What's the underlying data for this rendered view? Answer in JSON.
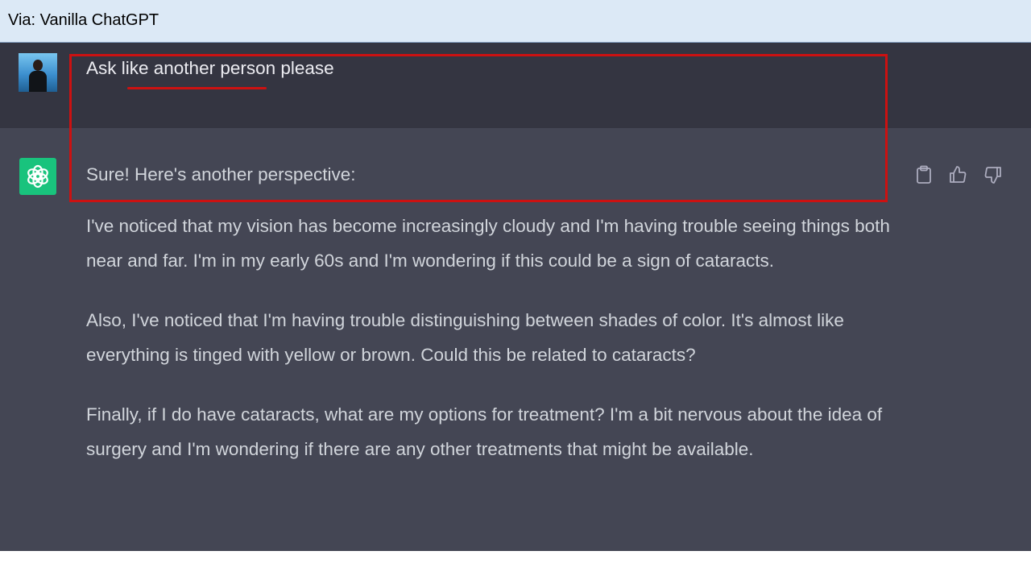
{
  "window": {
    "title": "Via: Vanilla ChatGPT"
  },
  "conversation": {
    "user_message": "Ask like another person please",
    "assistant": {
      "intro": "Sure! Here's another perspective:",
      "paragraphs": [
        "I've noticed that my vision has become increasingly cloudy and I'm having trouble seeing things both near and far. I'm in my early 60s and I'm wondering if this could be a sign of cataracts.",
        "Also, I've noticed that I'm having trouble distinguishing between shades of color. It's almost like everything is tinged with yellow or brown. Could this be related to cataracts?",
        "Finally, if I do have cataracts, what are my options for treatment? I'm a bit nervous about the idea of surgery and I'm wondering if there are any other treatments that might be available."
      ]
    },
    "action_icons": [
      "clipboard-icon",
      "thumbs-up-icon",
      "thumbs-down-icon"
    ]
  },
  "colors": {
    "user_row_bg": "#343541",
    "assistant_row_bg": "#444654",
    "assistant_logo_bg": "#19c37d",
    "annotation_red": "#cc1111",
    "title_bar_bg": "#dce9f6"
  }
}
